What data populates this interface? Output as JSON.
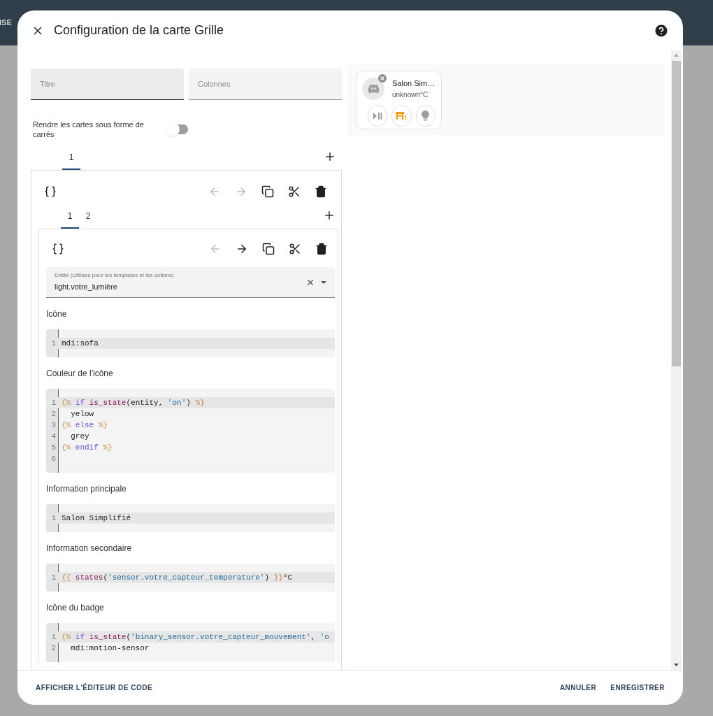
{
  "background": {
    "header_text": "ISE"
  },
  "dialog": {
    "title": "Configuration de la carte Grille"
  },
  "fields": [
    {
      "placeholder": "Titre",
      "focused": true
    },
    {
      "placeholder": "Colonnes",
      "focused": false
    }
  ],
  "square_toggle": {
    "label": "Rendre les cartes sous forme de carrés",
    "on": false
  },
  "outer_tabs": [
    {
      "label": "1",
      "selected": true
    }
  ],
  "outer_toolbar": [
    {
      "kind": "back",
      "disabled": true
    },
    {
      "kind": "forward",
      "disabled": true
    },
    {
      "kind": "copy",
      "disabled": false
    },
    {
      "kind": "cut",
      "disabled": false
    },
    {
      "kind": "delete",
      "disabled": false
    }
  ],
  "inner_tabs": [
    {
      "label": "1",
      "selected": true
    },
    {
      "label": "2",
      "selected": false
    }
  ],
  "inner_toolbar": [
    {
      "kind": "back",
      "disabled": true
    },
    {
      "kind": "forward",
      "disabled": false
    },
    {
      "kind": "copy",
      "disabled": false
    },
    {
      "kind": "cut",
      "disabled": false
    },
    {
      "kind": "delete",
      "disabled": false
    }
  ],
  "entity_field": {
    "label": "Entité (Utilisée pour les templates et les actions)",
    "value": "light.votre_lumière"
  },
  "editors": [
    {
      "label": "Icône",
      "lines": [
        {
          "number": "1",
          "active": true,
          "tokens": [
            {
              "kind": "plain",
              "text": "mdi:sofa"
            }
          ]
        }
      ]
    },
    {
      "label": "Couleur de l'icône",
      "lines": [
        {
          "number": "1",
          "active": true,
          "tokens": [
            {
              "kind": "delim",
              "text": "{% "
            },
            {
              "kind": "keyword",
              "text": "if "
            },
            {
              "kind": "function",
              "text": "is_state"
            },
            {
              "kind": "plain",
              "text": "(entity, "
            },
            {
              "kind": "string",
              "text": "'on'"
            },
            {
              "kind": "plain",
              "text": ") "
            },
            {
              "kind": "delim",
              "text": "%}"
            }
          ]
        },
        {
          "number": "2",
          "active": false,
          "tokens": [
            {
              "kind": "plain",
              "text": "  yelow"
            }
          ]
        },
        {
          "number": "3",
          "active": false,
          "tokens": [
            {
              "kind": "delim",
              "text": "{% "
            },
            {
              "kind": "keyword",
              "text": "else "
            },
            {
              "kind": "delim",
              "text": "%}"
            }
          ]
        },
        {
          "number": "4",
          "active": false,
          "tokens": [
            {
              "kind": "plain",
              "text": "  grey"
            }
          ]
        },
        {
          "number": "5",
          "active": false,
          "tokens": [
            {
              "kind": "delim",
              "text": "{% "
            },
            {
              "kind": "keyword",
              "text": "endif "
            },
            {
              "kind": "delim",
              "text": "%}"
            }
          ]
        },
        {
          "number": "6",
          "active": false
        }
      ]
    },
    {
      "label": "Information principale",
      "lines": [
        {
          "number": "1",
          "active": true,
          "tokens": [
            {
              "kind": "plain",
              "text": "Salon Simplifié"
            }
          ]
        }
      ]
    },
    {
      "label": "Information secondaire",
      "lines": [
        {
          "number": "1",
          "active": true,
          "tokens": [
            {
              "kind": "delim",
              "text": "{{ "
            },
            {
              "kind": "function",
              "text": "states"
            },
            {
              "kind": "plain",
              "text": "("
            },
            {
              "kind": "string",
              "text": "'sensor.votre_capteur_temperature'"
            },
            {
              "kind": "plain",
              "text": ") "
            },
            {
              "kind": "delim",
              "text": "}}"
            },
            {
              "kind": "plain",
              "text": "°C"
            }
          ]
        }
      ]
    },
    {
      "label": "Icône du badge",
      "lines": [
        {
          "number": "1",
          "active": true,
          "tokens": [
            {
              "kind": "delim",
              "text": "{% "
            },
            {
              "kind": "keyword",
              "text": "if "
            },
            {
              "kind": "function",
              "text": "is_state"
            },
            {
              "kind": "plain",
              "text": "("
            },
            {
              "kind": "string",
              "text": "'binary_sensor.votre_capteur_mouvement'"
            },
            {
              "kind": "plain",
              "text": ", "
            },
            {
              "kind": "string",
              "text": "'o"
            }
          ]
        },
        {
          "number": "2",
          "active": false,
          "tokens": [
            {
              "kind": "plain",
              "text": "  mdi:motion-sensor"
            }
          ]
        }
      ]
    }
  ],
  "preview": {
    "name": "Salon Sim…",
    "state": "unknown°C",
    "buttons": [
      {
        "kind": "play-pause",
        "color": "#9e9e9e"
      },
      {
        "kind": "table-alert",
        "color": "#ff9800"
      },
      {
        "kind": "bulb",
        "color": "#9e9e9e"
      }
    ]
  },
  "footer": {
    "left_action": "AFFICHER L'ÉDITEUR DE CODE",
    "actions": [
      "ANNULER",
      "ENREGISTRER"
    ]
  }
}
